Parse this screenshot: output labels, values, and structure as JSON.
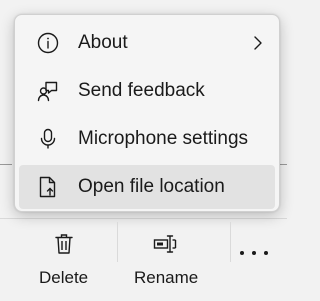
{
  "menu": {
    "items": [
      {
        "label": "About",
        "icon": "info-icon",
        "has_submenu": true
      },
      {
        "label": "Send feedback",
        "icon": "feedback-icon",
        "has_submenu": false
      },
      {
        "label": "Microphone settings",
        "icon": "microphone-icon",
        "has_submenu": false
      },
      {
        "label": "Open file location",
        "icon": "file-location-icon",
        "has_submenu": false,
        "highlighted": true
      }
    ]
  },
  "command_bar": {
    "delete_label": "Delete",
    "rename_label": "Rename",
    "more_icon": "more-icon"
  },
  "colors": {
    "menu_background": "#f5f5f5",
    "highlight": "#e2e2e2",
    "text": "#1a1a1a",
    "page_background": "#f2f2f2"
  }
}
